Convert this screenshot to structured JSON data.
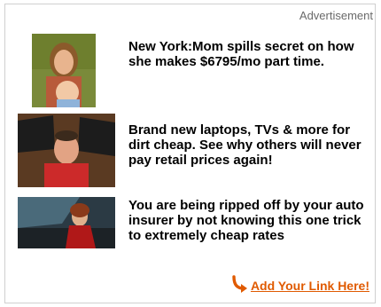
{
  "ad": {
    "label": "Advertisement",
    "items": [
      {
        "headline": "New York:Mom spills secret on how she makes $6795/mo part time.",
        "thumbnail": "mother-with-baby-photo"
      },
      {
        "headline": "Brand new laptops, TVs & more for dirt cheap. See why others will never pay retail prices again!",
        "thumbnail": "man-holding-laptops-photo"
      },
      {
        "headline": "You are being ripped off by your auto insurer by not knowing this one trick to extremely cheap rates",
        "thumbnail": "woman-in-car-photo"
      }
    ],
    "footer": {
      "link_text": "Add Your Link Here!",
      "icon": "curved-arrow-icon",
      "color": "#e05a00"
    }
  }
}
